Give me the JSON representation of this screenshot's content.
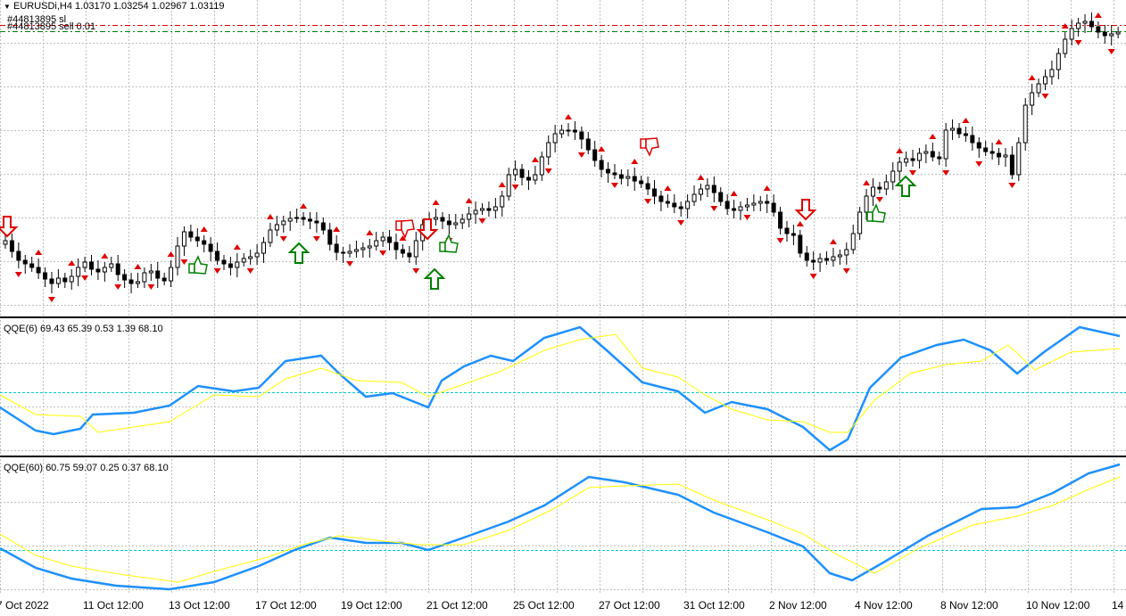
{
  "header": {
    "symbol_line": "EURUSDi,H4  1.03170 1.03254 1.02967 1.03119",
    "order_sl": "#44813895 sl",
    "order_sell": "#44813895 sell 0.01"
  },
  "indicators": {
    "qqe6_label": "QQE(6) 69.43 65.39 0.53 1.39 68.10",
    "qqe60_label": "QQE(60) 60.75 59.07 0.25 0.37 68.10"
  },
  "x_axis": {
    "labels": [
      "7 Oct 2022",
      "11 Oct 12:00",
      "13 Oct 12:00",
      "17 Oct 12:00",
      "19 Oct 12:00",
      "21 Oct 12:00",
      "25 Oct 12:00",
      "27 Oct 12:00",
      "31 Oct 12:00",
      "2 Nov 12:00",
      "4 Nov 12:00",
      "8 Nov 12:00",
      "10 Nov 12:00",
      "14"
    ]
  },
  "colors": {
    "background": "#ffffff",
    "grid": "#c0c0c0",
    "candle": "#000000",
    "qqe_fast": "#1e90ff",
    "qqe_slow": "#ffff00",
    "qqe_level": "#00cccc",
    "arrow_up": "#008000",
    "arrow_down": "#e00000",
    "sl_line": "#e00000",
    "order_line": "#008000"
  },
  "icons": {
    "up_signal": "thick-up-arrow-icon",
    "down_signal": "thick-down-arrow-icon",
    "thumbs_up": "thumbs-up-icon",
    "thumbs_down": "thumbs-down-icon",
    "fractal_up": "small-red-up-marker-icon",
    "fractal_down": "small-red-down-marker-icon"
  }
}
